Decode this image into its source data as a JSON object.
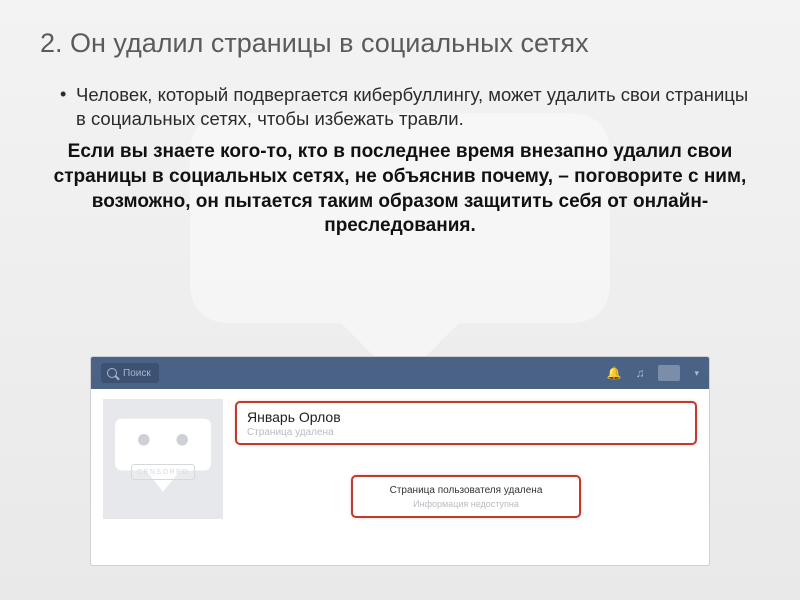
{
  "title": "2. Он удалил страницы в социальных сетях",
  "bullet": "Человек, который подвергается кибербуллингу, может удалить свои страницы в социальных сетях, чтобы избежать травли.",
  "emphasis": "Если вы знаете кого-то, кто в последнее время внезапно удалил свои страницы в социальных сетях, не объяснив почему, – поговорите с ним, возможно, он пытается таким образом защитить себя от онлайн-преследования.",
  "screenshot": {
    "search_placeholder": "Поиск",
    "profile_name": "Январь Орлов",
    "profile_sub": "Страница удалена",
    "deleted_title": "Страница пользователя удалена",
    "deleted_sub": "Информация недоступна",
    "censored": "CENSORED"
  },
  "colors": {
    "topbar": "#4a6286",
    "highlight_border": "#c03a2e"
  }
}
